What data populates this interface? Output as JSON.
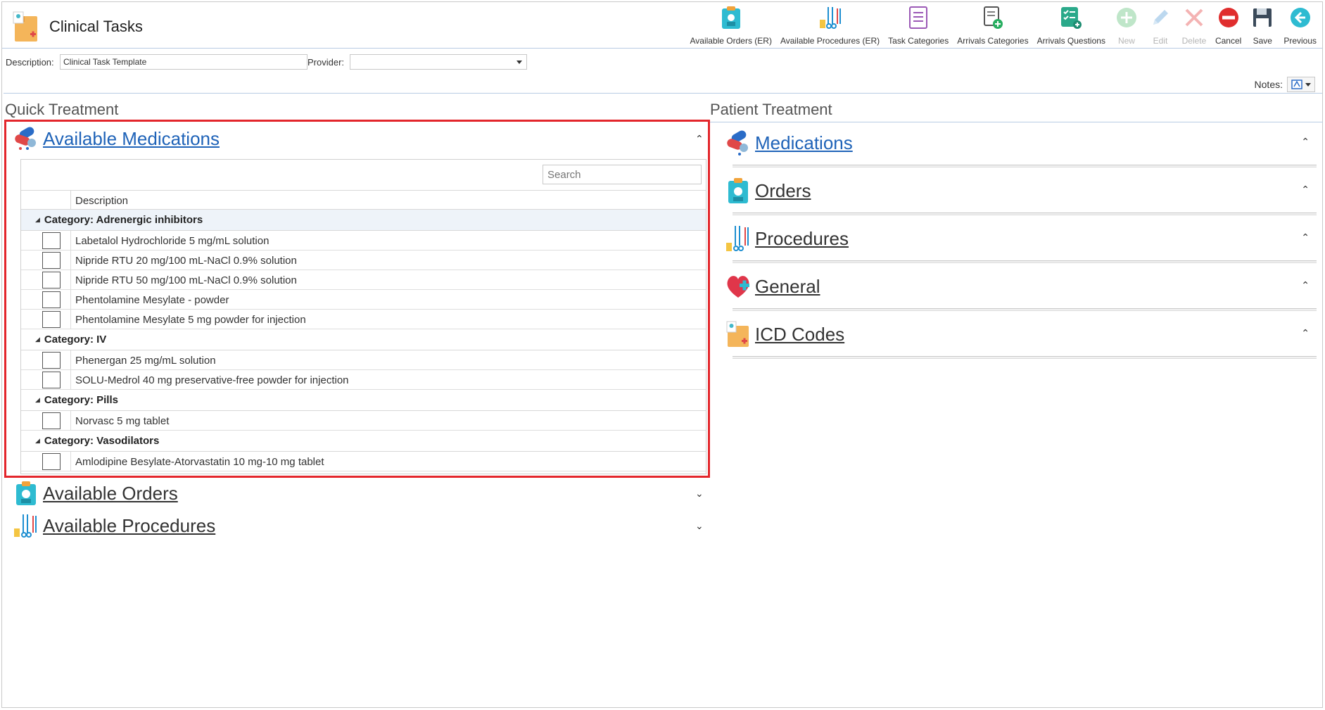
{
  "app": {
    "title": "Clinical Tasks"
  },
  "toolbar": {
    "buttons": [
      {
        "label": "Available Orders (ER)",
        "icon": "clipboard-orders-icon",
        "enabled": true
      },
      {
        "label": "Available Procedures (ER)",
        "icon": "surgical-tools-icon",
        "enabled": true
      },
      {
        "label": "Task Categories",
        "icon": "task-list-icon",
        "enabled": true
      },
      {
        "label": "Arrivals Categories",
        "icon": "document-add-icon",
        "enabled": true
      },
      {
        "label": "Arrivals Questions",
        "icon": "checklist-add-icon",
        "enabled": true
      },
      {
        "label": "New",
        "icon": "plus-circle-icon",
        "enabled": false
      },
      {
        "label": "Edit",
        "icon": "pencil-icon",
        "enabled": false
      },
      {
        "label": "Delete",
        "icon": "x-icon",
        "enabled": false
      },
      {
        "label": "Cancel",
        "icon": "no-entry-icon",
        "enabled": true
      },
      {
        "label": "Save",
        "icon": "floppy-disk-icon",
        "enabled": true
      },
      {
        "label": "Previous",
        "icon": "arrow-left-circle-icon",
        "enabled": true
      }
    ]
  },
  "form": {
    "description_label": "Description:",
    "description_value": "Clinical Task Template",
    "provider_label": "Provider:",
    "provider_value": ""
  },
  "notes": {
    "label": "Notes:"
  },
  "quick_treatment": {
    "title": "Quick Treatment",
    "available_medications": {
      "title": "Available Medications",
      "search_placeholder": "Search",
      "column_header": "Description",
      "categories": [
        {
          "name": "Category: Adrenergic inhibitors",
          "items": [
            "Labetalol Hydrochloride 5 mg/mL solution",
            "Nipride RTU 20 mg/100 mL-NaCl 0.9% solution",
            "Nipride RTU 50 mg/100 mL-NaCl 0.9% solution",
            "Phentolamine Mesylate - powder",
            "Phentolamine Mesylate 5 mg powder for injection"
          ]
        },
        {
          "name": "Category: IV",
          "items": [
            "Phenergan 25 mg/mL solution",
            "SOLU-Medrol 40 mg preservative-free powder for injection"
          ]
        },
        {
          "name": "Category: Pills",
          "items": [
            "Norvasc 5 mg tablet"
          ]
        },
        {
          "name": "Category: Vasodilators",
          "items": [
            "Amlodipine Besylate-Atorvastatin 10 mg-10 mg tablet"
          ]
        }
      ]
    },
    "available_orders": {
      "title": "Available Orders"
    },
    "available_procedures": {
      "title": "Available Procedures"
    }
  },
  "patient_treatment": {
    "title": "Patient Treatment",
    "groups": [
      {
        "title": "Medications",
        "icon": "pills-icon",
        "color": "#1f63b8"
      },
      {
        "title": "Orders",
        "icon": "clipboard-orders-icon",
        "color": "#333333"
      },
      {
        "title": "Procedures",
        "icon": "surgical-tools-icon",
        "color": "#333333"
      },
      {
        "title": "General",
        "icon": "heart-plus-icon",
        "color": "#333333"
      },
      {
        "title": "ICD Codes",
        "icon": "medical-folder-icon",
        "color": "#333333"
      }
    ]
  },
  "colors": {
    "accent_blue": "#1f63b8",
    "highlight_red": "#e3262c",
    "separator": "#b8cce4"
  }
}
